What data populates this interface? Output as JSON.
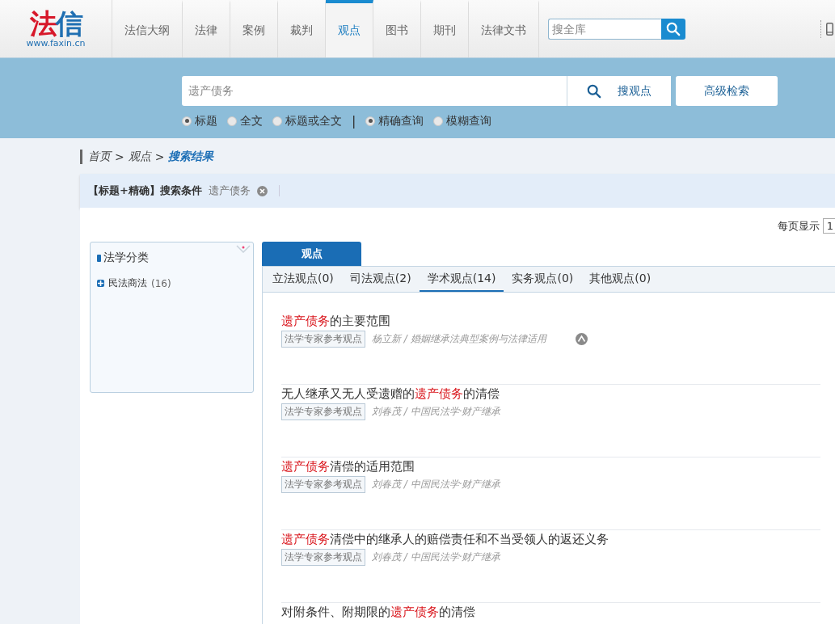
{
  "logo": {
    "characters": [
      {
        "text": "法",
        "color": "#d7182a"
      },
      {
        "text": "信",
        "color": "#1f6fb2"
      }
    ],
    "url": "www.faxin.cn"
  },
  "nav": [
    {
      "label": "法信大纲",
      "selected": false
    },
    {
      "label": "法律",
      "selected": false
    },
    {
      "label": "案例",
      "selected": false
    },
    {
      "label": "裁判",
      "selected": false
    },
    {
      "label": "观点",
      "selected": true
    },
    {
      "label": "图书",
      "selected": false
    },
    {
      "label": "期刊",
      "selected": false
    },
    {
      "label": "法律文书",
      "selected": false
    }
  ],
  "global_search": {
    "placeholder": "搜全库"
  },
  "search": {
    "value": "遗产债务",
    "button": "搜观点",
    "advanced": "高级检索",
    "scope": [
      {
        "label": "标题",
        "selected": true
      },
      {
        "label": "全文",
        "selected": false
      },
      {
        "label": "标题或全文",
        "selected": false
      }
    ],
    "separator": "|",
    "mode": [
      {
        "label": "精确查询",
        "selected": true
      },
      {
        "label": "模糊查询",
        "selected": false
      }
    ]
  },
  "breadcrumb": [
    {
      "label": "首页",
      "current": false
    },
    {
      "label": "观点",
      "current": false
    },
    {
      "label": "搜索结果",
      "current": true
    }
  ],
  "breadcrumb_separator": ">",
  "conditions": {
    "label": "【标题+精确】搜索条件",
    "term": "遗产债务"
  },
  "per_page": {
    "label": "每页显示",
    "value": "1"
  },
  "sidebar": {
    "title": "法学分类",
    "items": [
      {
        "label": "民法商法",
        "count": "(16)",
        "expanded": false
      }
    ]
  },
  "main_tab": "观点",
  "subtabs": [
    {
      "label": "立法观点(0)",
      "selected": false
    },
    {
      "label": "司法观点(2)",
      "selected": false
    },
    {
      "label": "学术观点(14)",
      "selected": true
    },
    {
      "label": "实务观点(0)",
      "selected": false
    },
    {
      "label": "其他观点(0)",
      "selected": false
    }
  ],
  "results": [
    {
      "title": [
        {
          "text": "遗产债务",
          "highlight": true
        },
        {
          "text": "的主要范围",
          "highlight": false
        }
      ],
      "tag": "法学专家参考观点",
      "source": "杨立新 / 婚姻继承法典型案例与法律适用",
      "flagged": true
    },
    {
      "title": [
        {
          "text": "无人继承又无人受遗赠的",
          "highlight": false
        },
        {
          "text": "遗产债务",
          "highlight": true
        },
        {
          "text": "的清偿",
          "highlight": false
        }
      ],
      "tag": "法学专家参考观点",
      "source": "刘春茂 / 中国民法学·财产继承",
      "flagged": false
    },
    {
      "title": [
        {
          "text": "遗产债务",
          "highlight": true
        },
        {
          "text": "清偿的适用范围",
          "highlight": false
        }
      ],
      "tag": "法学专家参考观点",
      "source": "刘春茂 / 中国民法学·财产继承",
      "flagged": false
    },
    {
      "title": [
        {
          "text": "遗产债务",
          "highlight": true
        },
        {
          "text": "清偿中的继承人的赔偿责任和不当受领人的返还义务",
          "highlight": false
        }
      ],
      "tag": "法学专家参考观点",
      "source": "刘春茂 / 中国民法学·财产继承",
      "flagged": false
    },
    {
      "title": [
        {
          "text": "对附条件、附期限的",
          "highlight": false
        },
        {
          "text": "遗产债务",
          "highlight": true
        },
        {
          "text": "的清偿",
          "highlight": false
        }
      ],
      "flagged": false
    }
  ]
}
